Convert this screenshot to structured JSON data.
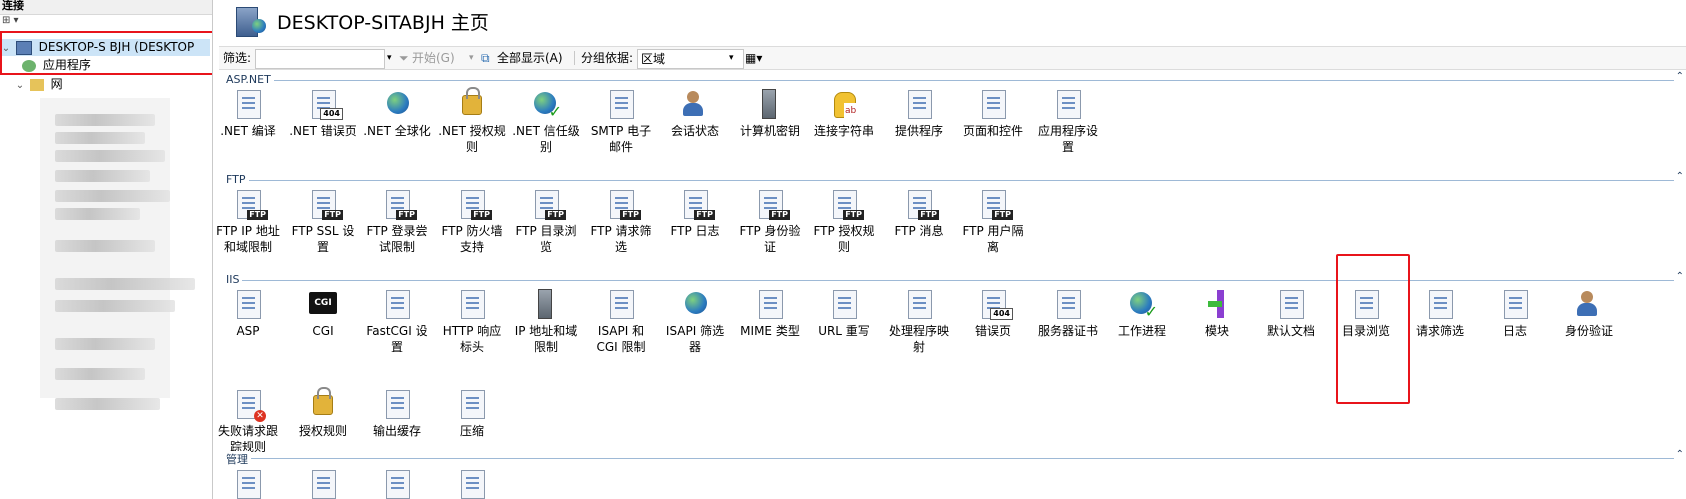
{
  "left_pane": {
    "header": "连接",
    "tree": [
      {
        "label": "DESKTOP-S  BJH (DESKTOP",
        "selected": true
      },
      {
        "label": "应用程序"
      },
      {
        "label": "网"
      }
    ]
  },
  "main": {
    "title": "DESKTOP-SITABJH 主页",
    "toolbar": {
      "filter_label": "筛选:",
      "start_label": "开始(G)",
      "show_all_label": "全部显示(A)",
      "group_by_label": "分组依据:",
      "group_by_value": "区域"
    },
    "groups": [
      {
        "name": "ASP.NET",
        "items": [
          {
            "label": ".NET 编译",
            "icon": "net-compilation-icon"
          },
          {
            "label": ".NET 错误页",
            "icon": "net-error-pages-icon"
          },
          {
            "label": ".NET 全球化",
            "icon": "net-globalization-icon"
          },
          {
            "label": ".NET 授权规则",
            "icon": "net-authorization-rules-icon"
          },
          {
            "label": ".NET 信任级别",
            "icon": "net-trust-levels-icon"
          },
          {
            "label": "SMTP 电子邮件",
            "icon": "smtp-email-icon"
          },
          {
            "label": "会话状态",
            "icon": "session-state-icon"
          },
          {
            "label": "计算机密钥",
            "icon": "machine-key-icon"
          },
          {
            "label": "连接字符串",
            "icon": "connection-strings-icon"
          },
          {
            "label": "提供程序",
            "icon": "providers-icon"
          },
          {
            "label": "页面和控件",
            "icon": "pages-controls-icon"
          },
          {
            "label": "应用程序设置",
            "icon": "app-settings-icon"
          }
        ]
      },
      {
        "name": "FTP",
        "items": [
          {
            "label": "FTP IP 地址和域限制",
            "icon": "ftp-ip-restrictions-icon"
          },
          {
            "label": "FTP SSL 设置",
            "icon": "ftp-ssl-icon"
          },
          {
            "label": "FTP 登录尝试限制",
            "icon": "ftp-logon-attempts-icon"
          },
          {
            "label": "FTP 防火墙支持",
            "icon": "ftp-firewall-icon"
          },
          {
            "label": "FTP 目录浏览",
            "icon": "ftp-directory-browsing-icon"
          },
          {
            "label": "FTP 请求筛选",
            "icon": "ftp-request-filtering-icon"
          },
          {
            "label": "FTP 日志",
            "icon": "ftp-logging-icon"
          },
          {
            "label": "FTP 身份验证",
            "icon": "ftp-authentication-icon"
          },
          {
            "label": "FTP 授权规则",
            "icon": "ftp-authorization-icon"
          },
          {
            "label": "FTP 消息",
            "icon": "ftp-messages-icon"
          },
          {
            "label": "FTP 用户隔离",
            "icon": "ftp-user-isolation-icon"
          }
        ]
      },
      {
        "name": "IIS",
        "items": [
          {
            "label": "ASP",
            "icon": "asp-icon"
          },
          {
            "label": "CGI",
            "icon": "cgi-icon"
          },
          {
            "label": "FastCGI 设置",
            "icon": "fastcgi-icon"
          },
          {
            "label": "HTTP 响应标头",
            "icon": "http-headers-icon"
          },
          {
            "label": "IP 地址和域限制",
            "icon": "ip-restrictions-icon"
          },
          {
            "label": "ISAPI 和 CGI 限制",
            "icon": "isapi-cgi-restrictions-icon"
          },
          {
            "label": "ISAPI 筛选器",
            "icon": "isapi-filters-icon"
          },
          {
            "label": "MIME 类型",
            "icon": "mime-types-icon"
          },
          {
            "label": "URL 重写",
            "icon": "url-rewrite-icon"
          },
          {
            "label": "处理程序映射",
            "icon": "handler-mappings-icon"
          },
          {
            "label": "错误页",
            "icon": "error-pages-icon"
          },
          {
            "label": "服务器证书",
            "icon": "server-certificates-icon"
          },
          {
            "label": "工作进程",
            "icon": "worker-processes-icon"
          },
          {
            "label": "模块",
            "icon": "modules-icon"
          },
          {
            "label": "默认文档",
            "icon": "default-document-icon"
          },
          {
            "label": "目录浏览",
            "icon": "directory-browsing-icon"
          },
          {
            "label": "请求筛选",
            "icon": "request-filtering-icon"
          },
          {
            "label": "日志",
            "icon": "logging-icon"
          },
          {
            "label": "身份验证",
            "icon": "authentication-icon"
          },
          {
            "label": "失败请求跟踪规则",
            "icon": "failed-request-tracing-icon"
          },
          {
            "label": "授权规则",
            "icon": "authorization-rules-icon"
          },
          {
            "label": "输出缓存",
            "icon": "output-caching-icon"
          },
          {
            "label": "压缩",
            "icon": "compression-icon"
          }
        ]
      },
      {
        "name": "管理",
        "items": []
      }
    ]
  }
}
